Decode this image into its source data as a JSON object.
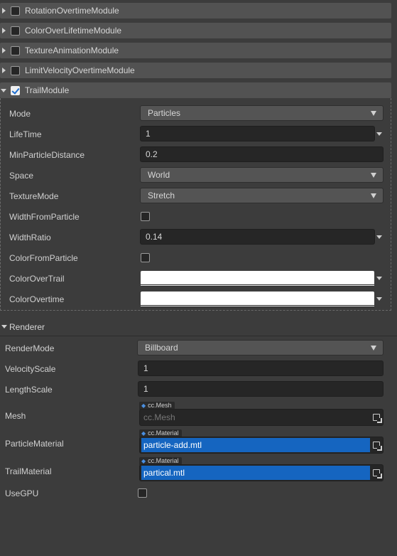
{
  "modules": [
    {
      "label": "RotationOvertimeModule",
      "checked": false,
      "expanded": false
    },
    {
      "label": "ColorOverLifetimeModule",
      "checked": false,
      "expanded": false
    },
    {
      "label": "TextureAnimationModule",
      "checked": false,
      "expanded": false
    },
    {
      "label": "LimitVelocityOvertimeModule",
      "checked": false,
      "expanded": false
    },
    {
      "label": "TrailModule",
      "checked": true,
      "expanded": true
    }
  ],
  "trail": {
    "mode": {
      "label": "Mode",
      "value": "Particles"
    },
    "lifetime": {
      "label": "LifeTime",
      "value": "1"
    },
    "min_particle_distance": {
      "label": "MinParticleDistance",
      "value": "0.2"
    },
    "space": {
      "label": "Space",
      "value": "World"
    },
    "texture_mode": {
      "label": "TextureMode",
      "value": "Stretch"
    },
    "width_from_particle": {
      "label": "WidthFromParticle",
      "checked": false
    },
    "width_ratio": {
      "label": "WidthRatio",
      "value": "0.14"
    },
    "color_from_particle": {
      "label": "ColorFromParticle",
      "checked": false
    },
    "color_over_trail": {
      "label": "ColorOverTrail",
      "color": "#ffffff"
    },
    "color_overtime": {
      "label": "ColorOvertime",
      "color": "#ffffff"
    }
  },
  "renderer": {
    "title": "Renderer",
    "render_mode": {
      "label": "RenderMode",
      "value": "Billboard"
    },
    "velocity_scale": {
      "label": "VelocityScale",
      "value": "1"
    },
    "length_scale": {
      "label": "LengthScale",
      "value": "1"
    },
    "mesh": {
      "label": "Mesh",
      "type_tag": "cc.Mesh",
      "placeholder": "cc.Mesh",
      "value": ""
    },
    "particle_material": {
      "label": "ParticleMaterial",
      "type_tag": "cc.Material",
      "value": "particle-add.mtl"
    },
    "trail_material": {
      "label": "TrailMaterial",
      "type_tag": "cc.Material",
      "value": "partical.mtl"
    },
    "use_gpu": {
      "label": "UseGPU",
      "checked": false
    }
  },
  "colors": {
    "panel_bg": "#3c3c3c",
    "header_bg": "#525252",
    "accent": "#1565c0",
    "field_bg": "#262626"
  }
}
